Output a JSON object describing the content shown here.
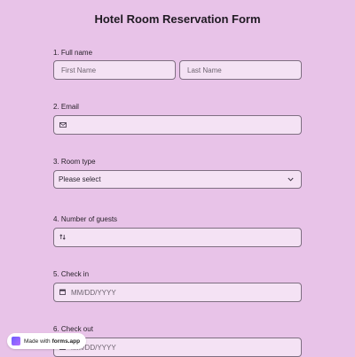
{
  "form": {
    "title": "Hotel Room Reservation Form",
    "full_name": {
      "label": "1.  Full name",
      "first_placeholder": "First Name",
      "last_placeholder": "Last Name"
    },
    "email": {
      "label": "2.  Email",
      "icon": "envelope-icon",
      "value": ""
    },
    "room_type": {
      "label": "3.  Room type",
      "selected": "Please select",
      "icon": "chevron-down-icon"
    },
    "guests": {
      "label": "4.  Number of guests",
      "icon": "stepper-icon",
      "value": ""
    },
    "check_in": {
      "label": "5.  Check in",
      "placeholder": "MM/DD/YYYY",
      "icon": "calendar-icon"
    },
    "check_out": {
      "label": "6.  Check out",
      "placeholder": "MM/DD/YYYY",
      "icon": "calendar-icon"
    }
  },
  "badge": {
    "prefix": "Made with",
    "brand": "forms.app"
  },
  "colors": {
    "background": "#e8c3e8",
    "field": "#f4e2f4",
    "border": "#7f6f82"
  }
}
